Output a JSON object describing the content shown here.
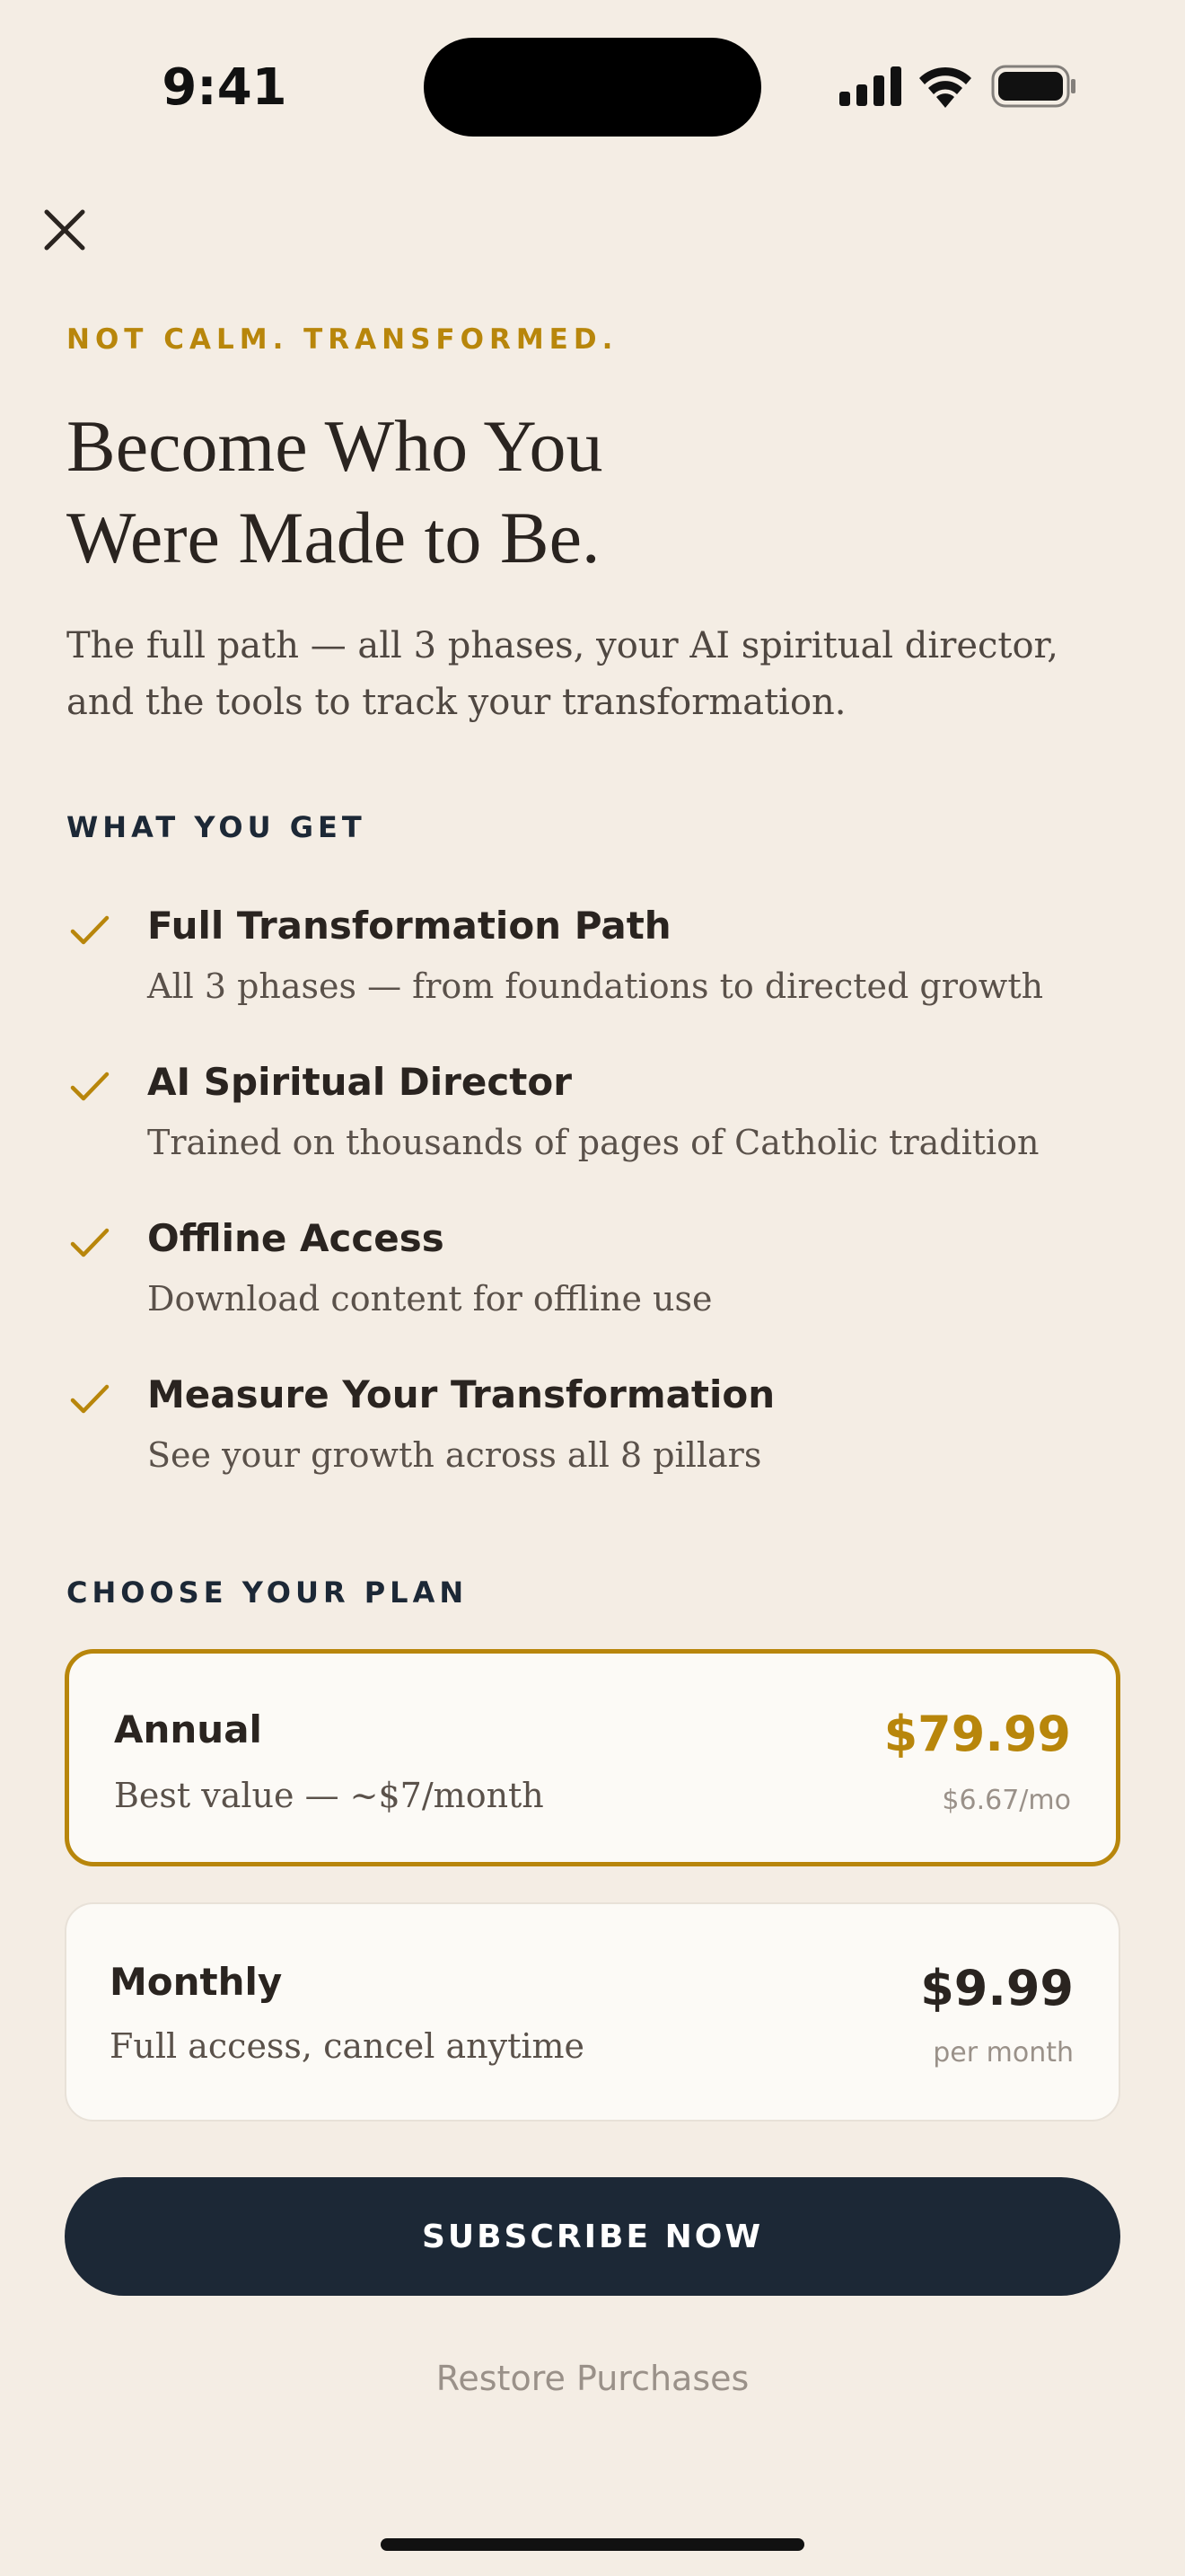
{
  "status_bar": {
    "time": "9:41",
    "icons": [
      "signal-icon",
      "wifi-icon",
      "battery-icon"
    ]
  },
  "close_icon": "close-icon",
  "hero": {
    "eyebrow": "NOT CALM. TRANSFORMED.",
    "headline_line1": "Become Who You",
    "headline_line2": "Were Made to Be.",
    "subtitle": "The full path — all 3 phases, your AI spiritual director, and the tools to track your transformation."
  },
  "features": {
    "label": "WHAT YOU GET",
    "items": [
      {
        "title": "Full Transformation Path",
        "desc": "All 3 phases — from foundations to directed growth"
      },
      {
        "title": "AI Spiritual Director",
        "desc": "Trained on thousands of pages of Catholic tradition"
      },
      {
        "title": "Offline Access",
        "desc": "Download content for offline use"
      },
      {
        "title": "Measure Your Transformation",
        "desc": "See your growth across all 8 pillars"
      }
    ]
  },
  "plans": {
    "label": "CHOOSE YOUR PLAN",
    "annual": {
      "name": "Annual",
      "desc": "Best value — ~$7/month",
      "price": "$79.99",
      "sub": "$6.67/mo",
      "selected": true
    },
    "monthly": {
      "name": "Monthly",
      "desc": "Full access, cancel anytime",
      "price": "$9.99",
      "sub": "per month",
      "selected": false
    }
  },
  "actions": {
    "subscribe_label": "SUBSCRIBE NOW",
    "restore_label": "Restore Purchases"
  },
  "colors": {
    "background": "#F4EDE4",
    "accent_gold": "#B8860B",
    "navy": "#1C2836",
    "card": "#FCFAF6"
  }
}
